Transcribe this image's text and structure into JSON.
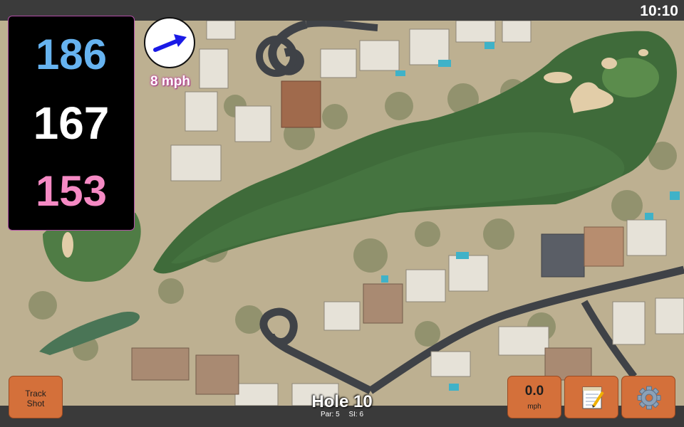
{
  "status": {
    "time": "10:10"
  },
  "distances": {
    "back": "186",
    "middle": "167",
    "front": "153"
  },
  "wind": {
    "speed": "8 mph",
    "direction_icon": "arrow-east-icon",
    "color": "#1a1ae6"
  },
  "hole": {
    "title": "Hole 10",
    "par": "Par: 5",
    "si": "SI: 6"
  },
  "buttons": {
    "track_shot_line1": "Track",
    "track_shot_line2": "Shot",
    "speed_value": "0.0",
    "speed_unit": "mph",
    "notes_icon": "notepad-icon",
    "settings_icon": "gear-icon"
  },
  "colors": {
    "button": "#d4703a",
    "back_distance": "#66b3f0",
    "front_distance": "#f58ac4",
    "panel_border": "#b24ea8"
  }
}
